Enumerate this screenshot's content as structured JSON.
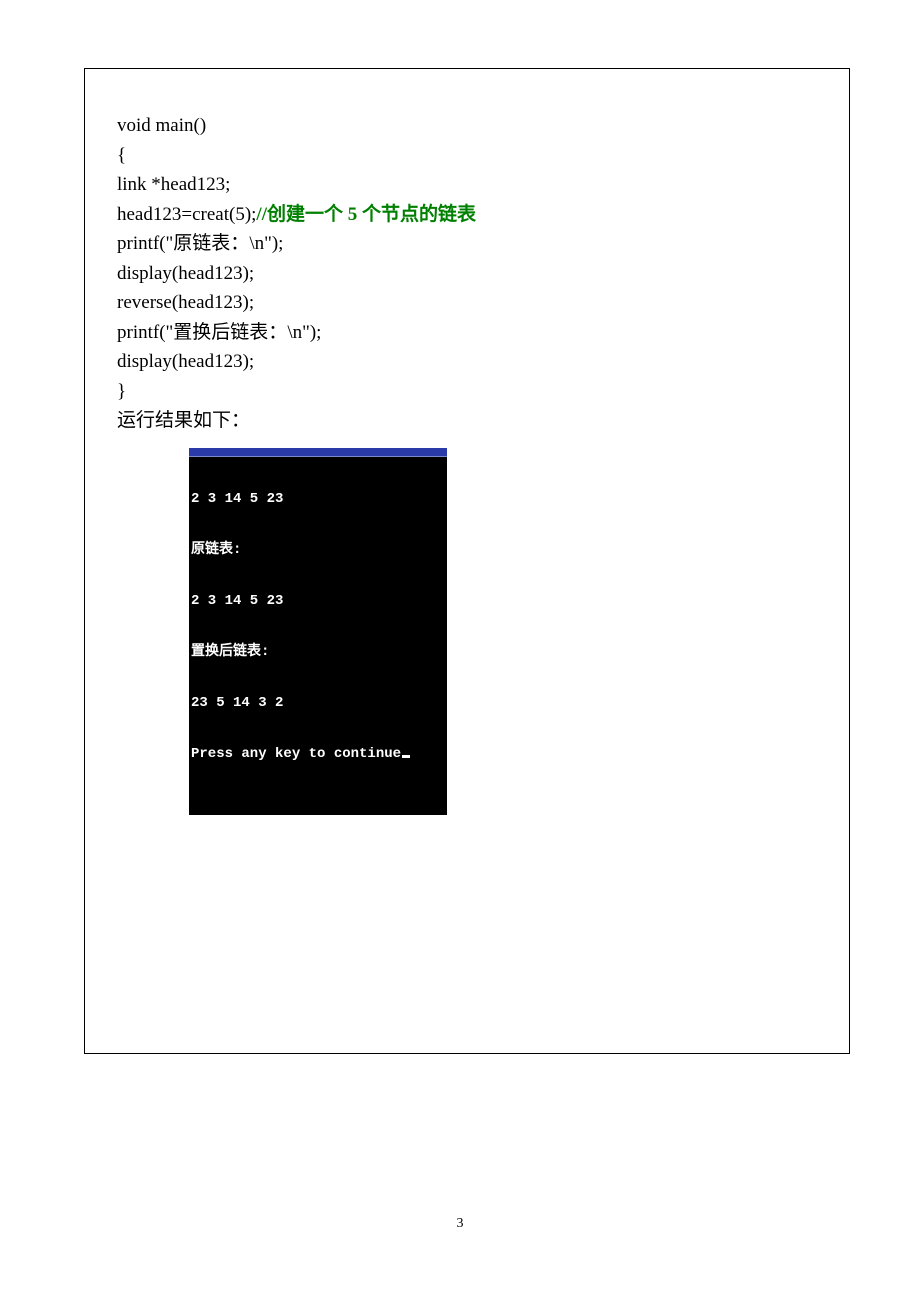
{
  "code": {
    "l1": "void main()",
    "l2": "{",
    "l3": "link *head123;",
    "l4a": "head123=creat(5);",
    "l4b": "//创建一个 5 个节点的链表",
    "l5a": "printf(\"",
    "l5b": "原链表：",
    "l5c": "\\n\");",
    "l6": "display(head123);",
    "l7": "reverse(head123);",
    "l8a": "printf(\"",
    "l8b": "置换后链表：",
    "l8c": "\\n\");",
    "l9": "display(head123);",
    "l10": "}"
  },
  "result_label": "运行结果如下：",
  "console": {
    "l1": "2 3 14 5 23",
    "l2": "原链表:",
    "l3": "2 3 14 5 23",
    "l4": "置换后链表:",
    "l5": "23 5 14 3 2",
    "l6": "Press any key to continue"
  },
  "page_number": "3"
}
